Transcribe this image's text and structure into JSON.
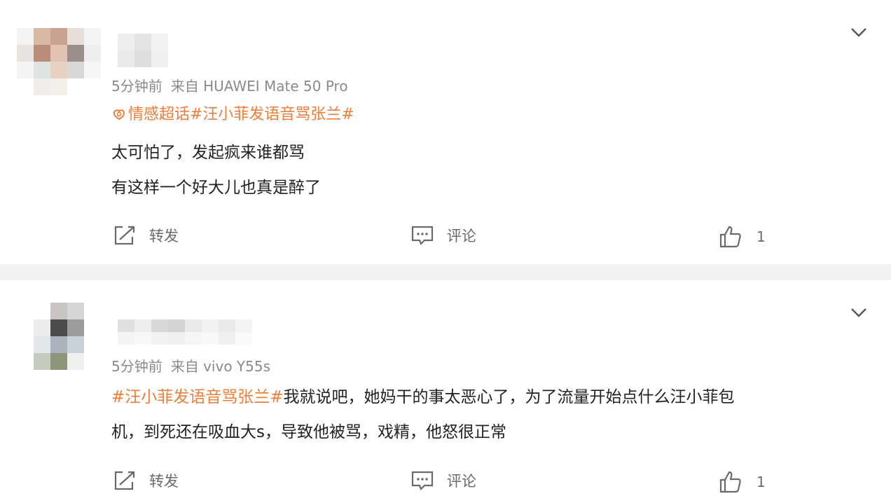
{
  "comments": [
    {
      "meta": {
        "time": "5分钟前",
        "source": "来自 HUAWEI Mate 50 Pro"
      },
      "topic": {
        "icon": "super-topic-icon",
        "text": "情感超话#汪小菲发语音骂张兰#"
      },
      "lines": [
        "太可怕了，发起疯来谁都骂",
        "有这样一个好大儿也真是醉了"
      ],
      "actions": {
        "repost": "转发",
        "comment": "评论",
        "like_count": "1"
      }
    },
    {
      "meta": {
        "time": "5分钟前",
        "source": "来自 vivo Y55s"
      },
      "tag": "#汪小菲发语音骂张兰#",
      "line1_rest": "我就说吧，她妈干的事太恶心了，为了流量开始点什么汪小菲包",
      "line2": "机，到死还在吸血大s，导致他被骂，戏精，他怒很正常",
      "actions": {
        "repost": "转发",
        "comment": "评论",
        "like_count": "1"
      }
    }
  ],
  "colors": {
    "accent": "#ee7e3a",
    "meta": "#8a8a8a",
    "separator": "#f2f2f2"
  },
  "icons": [
    "chevron-down-icon",
    "super-topic-icon",
    "repost-icon",
    "comment-icon",
    "like-icon"
  ]
}
